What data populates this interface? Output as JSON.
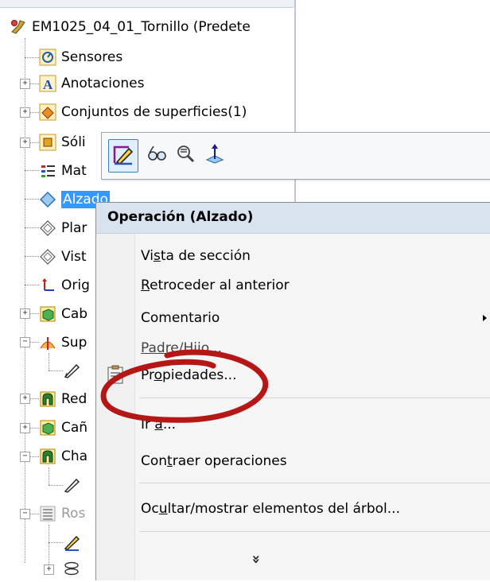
{
  "tree": {
    "root_label": "EM1025_04_01_Tornillo  (Predete",
    "items": [
      {
        "label": "Sensores"
      },
      {
        "label": "Anotaciones"
      },
      {
        "label": "Conjuntos de superficies(1)"
      },
      {
        "label": "Sóli"
      },
      {
        "label": "Mat"
      },
      {
        "label": "Alzado"
      },
      {
        "label": "Plar"
      },
      {
        "label": "Vist"
      },
      {
        "label": "Orig"
      },
      {
        "label": "Cab"
      },
      {
        "label": "Sup"
      },
      {
        "label": "Red"
      },
      {
        "label": "Cañ"
      },
      {
        "label": "Cha"
      },
      {
        "label": "Ros"
      }
    ]
  },
  "context_menu": {
    "header": "Operación (Alzado)",
    "items": {
      "vista": {
        "pre": "Vi",
        "u": "s",
        "post": "ta de sección"
      },
      "retroceder": {
        "pre": "",
        "u": "R",
        "post": "etroceder al anterior"
      },
      "comentario": {
        "label": "Comentario"
      },
      "padre": {
        "label": "Padre/Hijo..."
      },
      "propiedades": {
        "pre": "Pr",
        "u": "o",
        "post": "piedades..."
      },
      "ir": {
        "pre": "Ir ",
        "u": "a",
        "post": "..."
      },
      "contraer": {
        "pre": "Con",
        "u": "t",
        "post": "raer operaciones"
      },
      "ocultar": {
        "pre": "Oc",
        "u": "u",
        "post": "ltar/mostrar elementos del árbol..."
      },
      "expand": "»"
    }
  },
  "colors": {
    "selection": "#3399ff",
    "menu_header_bg": "#d9e3ef",
    "annotation": "#b51717"
  },
  "icons": {
    "toolbar": [
      "edit-sketch-icon",
      "view-glasses-icon",
      "zoom-selection-icon",
      "normal-to-icon"
    ],
    "menu": [
      "properties-icon"
    ]
  }
}
